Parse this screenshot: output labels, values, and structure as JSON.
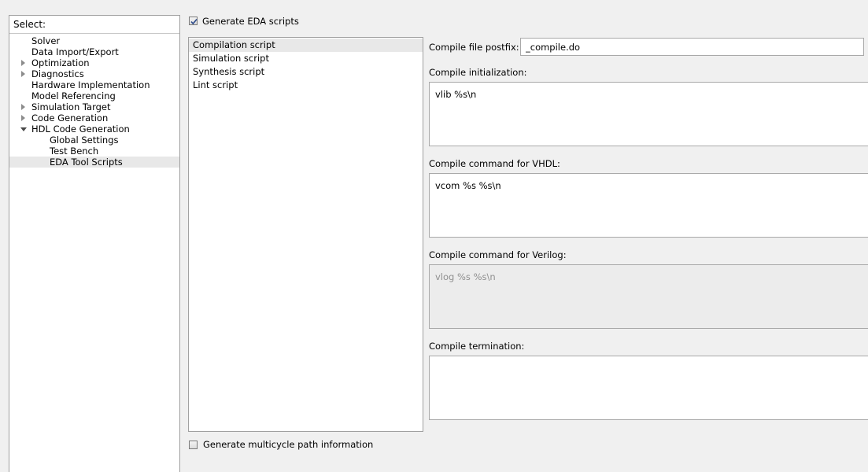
{
  "tree": {
    "select_label": "Select:",
    "items": [
      {
        "label": "Solver",
        "expander": "none"
      },
      {
        "label": "Data Import/Export",
        "expander": "none"
      },
      {
        "label": "Optimization",
        "expander": "collapsed"
      },
      {
        "label": "Diagnostics",
        "expander": "collapsed"
      },
      {
        "label": "Hardware Implementation",
        "expander": "none"
      },
      {
        "label": "Model Referencing",
        "expander": "none"
      },
      {
        "label": "Simulation Target",
        "expander": "collapsed"
      },
      {
        "label": "Code Generation",
        "expander": "collapsed"
      },
      {
        "label": "HDL Code Generation",
        "expander": "expanded"
      },
      {
        "label": "Global Settings",
        "expander": "none"
      },
      {
        "label": "Test Bench",
        "expander": "none"
      },
      {
        "label": "EDA Tool Scripts",
        "expander": "none",
        "selected": true
      }
    ]
  },
  "generate_eda": {
    "label": "Generate EDA scripts",
    "checked": true
  },
  "script_list": {
    "items": [
      {
        "label": "Compilation script",
        "selected": true
      },
      {
        "label": "Simulation script"
      },
      {
        "label": "Synthesis script"
      },
      {
        "label": "Lint script"
      }
    ]
  },
  "form": {
    "postfix_label": "Compile file postfix:",
    "postfix_value": "_compile.do",
    "init_label": "Compile initialization:",
    "init_value": "vlib %s\\n",
    "vhdl_label": "Compile command for VHDL:",
    "vhdl_value": "vcom %s %s\\n",
    "verilog_label": "Compile command for Verilog:",
    "verilog_value": "vlog %s %s\\n",
    "termination_label": "Compile termination:",
    "termination_value": ""
  },
  "multicycle": {
    "label": "Generate multicycle path information",
    "checked": false
  }
}
